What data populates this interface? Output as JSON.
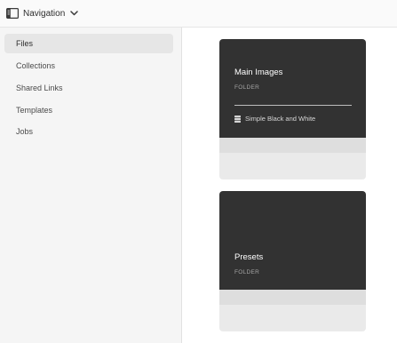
{
  "header": {
    "nav_label": "Navigation",
    "rail_icon": "left-rail-icon",
    "chevron_icon": "chevron-down-icon"
  },
  "sidebar": {
    "items": [
      {
        "label": "Files",
        "selected": true
      },
      {
        "label": "Collections",
        "selected": false
      },
      {
        "label": "Shared Links",
        "selected": false
      },
      {
        "label": "Templates",
        "selected": false
      },
      {
        "label": "Jobs",
        "selected": false
      }
    ]
  },
  "cards": [
    {
      "title": "Main Images",
      "kind": "FOLDER",
      "meta_icon": "stack-icon",
      "meta_text": "Simple Black and White"
    },
    {
      "title": "Presets",
      "kind": "FOLDER"
    }
  ],
  "colors": {
    "card_dark": "#323232",
    "sidebar_bg": "#f5f5f5",
    "selected_bg": "#e6e6e6"
  }
}
